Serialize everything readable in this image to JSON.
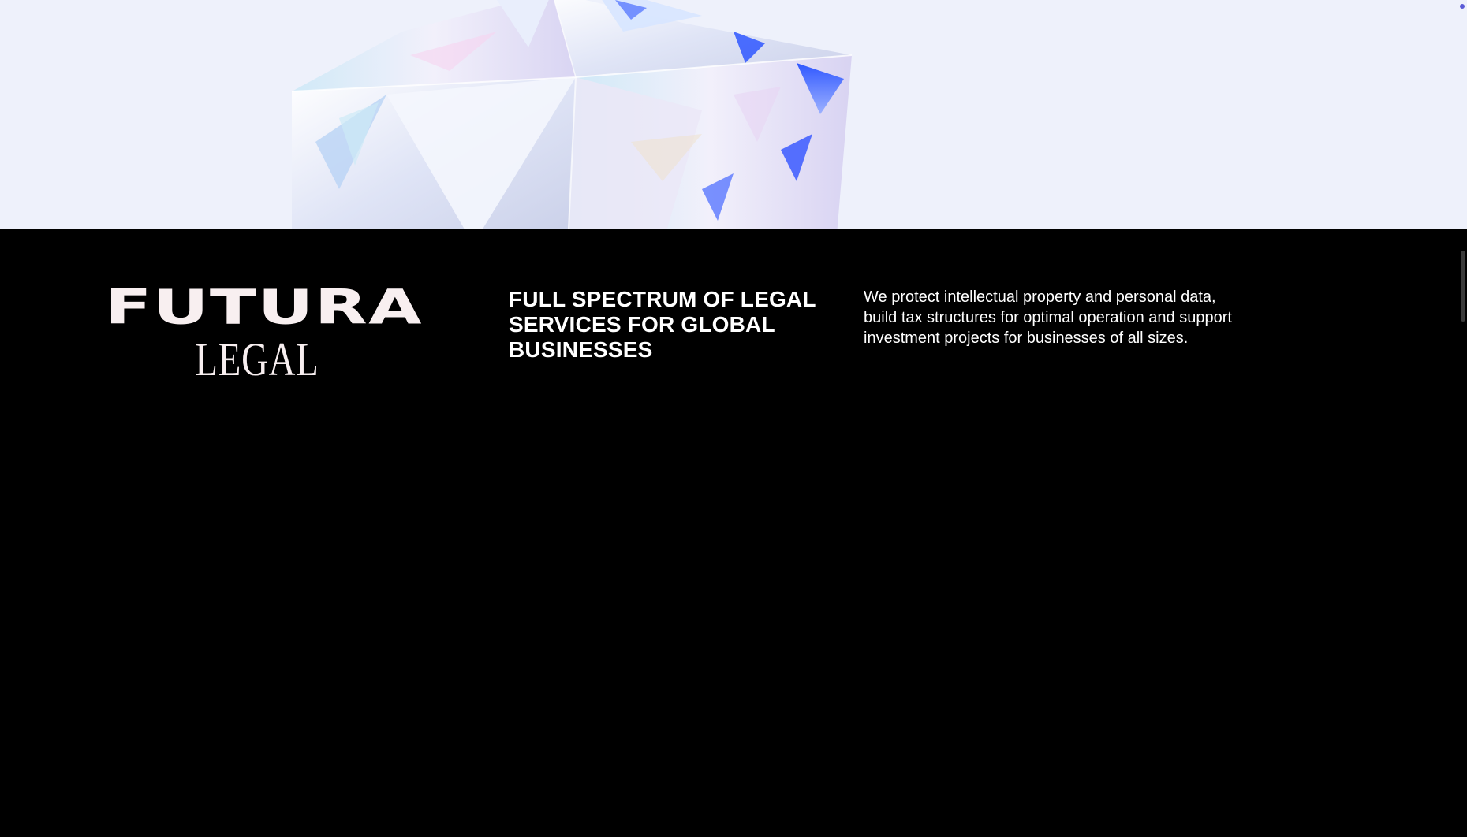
{
  "brand": {
    "logo_top": "FUTURA",
    "logo_bottom": "LEGAL"
  },
  "intro": {
    "headline": "FULL SPECTRUM OF LEGAL SERVICES FOR GLOBAL BUSINESSES",
    "description": "We protect intellectual property and personal data, build tax structures for optimal operation and support investment projects for businesses of all sizes."
  },
  "colors": {
    "hero_background": "#eef1fb",
    "footer_background": "#000000",
    "text": "#ffffff",
    "logo": "#f8eff0"
  }
}
